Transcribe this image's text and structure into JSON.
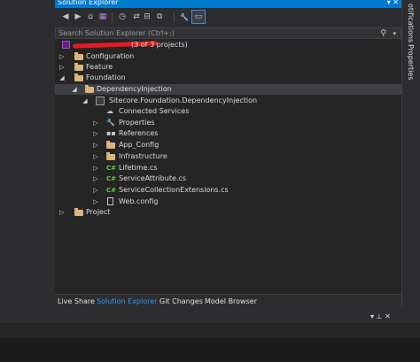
{
  "window": {
    "title": "Solution Explorer",
    "controls": "▾ ✕"
  },
  "toolbar": {
    "back": "◀",
    "forward": "▶",
    "home": "⌂",
    "switch_view": "▦",
    "pending": "◷",
    "sync": "⇄",
    "collapse": "⊟",
    "show_all": "⧉",
    "properties": "🔧",
    "preview": "▭"
  },
  "search": {
    "placeholder": "Search Solution Explorer (Ctrl+;)",
    "icon": "⚲",
    "options": "▾"
  },
  "tree": {
    "solution_suffix": "(3 of 3 projects)",
    "items": [
      {
        "label": "Configuration",
        "arrow": "▷"
      },
      {
        "label": "Feature",
        "arrow": "▷"
      },
      {
        "label": "Foundation",
        "arrow": "◢"
      },
      {
        "label": "DependencyInjection",
        "arrow": "◢"
      },
      {
        "label": "Sitecore.Foundation.DependencyInjection",
        "arrow": "◢"
      },
      {
        "label": "Connected Services",
        "arrow": ""
      },
      {
        "label": "Properties",
        "arrow": "▷"
      },
      {
        "label": "References",
        "arrow": "▷"
      },
      {
        "label": "App_Config",
        "arrow": "▷"
      },
      {
        "label": "Infrastructure",
        "arrow": "▷"
      },
      {
        "label": "Lifetime.cs",
        "arrow": "▷"
      },
      {
        "label": "ServiceAttribute.cs",
        "arrow": "▷"
      },
      {
        "label": "ServiceCollectionExtensions.cs",
        "arrow": "▷"
      },
      {
        "label": "Web.config",
        "arrow": "▷"
      },
      {
        "label": "Project",
        "arrow": "▷"
      }
    ]
  },
  "tabs": [
    {
      "label": "Live Share"
    },
    {
      "label": "Solution Explorer"
    },
    {
      "label": "Git Changes"
    },
    {
      "label": "Model Browser"
    }
  ],
  "right_rail": {
    "notifications": "otifications",
    "properties": "Properties"
  },
  "bottom_panel": {
    "controls": "▾ ⊥ ✕"
  },
  "colors": {
    "accent": "#007acc",
    "folder": "#dcb67a",
    "csharp": "#6cc644",
    "active_tab": "#3794ff",
    "redaction": "#e51c23"
  }
}
